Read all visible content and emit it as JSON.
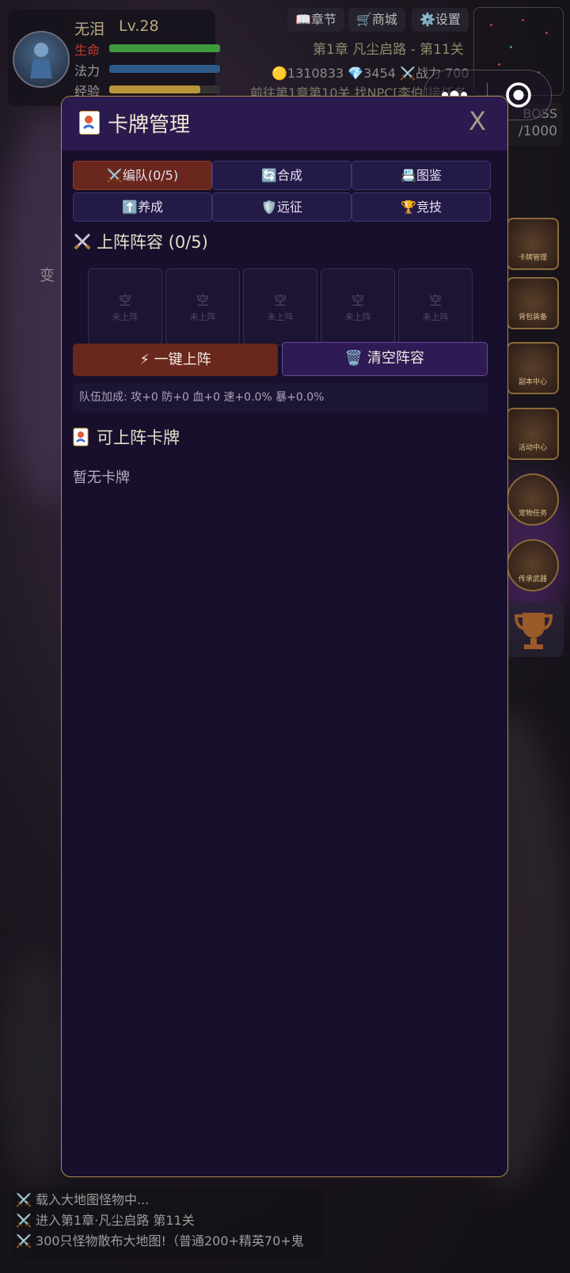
{
  "player": {
    "name": "无泪",
    "level": "Lv.28",
    "stats": [
      {
        "label": "生命",
        "color": "#c23a2f",
        "fill": "#3f9a3c"
      },
      {
        "label": "法力",
        "color": "#b0b0b0",
        "fill": "#2d6aa0"
      },
      {
        "label": "经验",
        "color": "#b0b0b0",
        "fill": "#c8a43c"
      }
    ]
  },
  "toolbar": {
    "chapter_btn": "📖章节",
    "shop_btn": "🛒商城",
    "settings_btn": "⚙️设置"
  },
  "stage": {
    "title": "第1章 凡尘启路 - 第11关",
    "gold": "🟡1310833",
    "gems": "💎3454",
    "power": "⚔️战力 700",
    "quest": "前往第1章第10关 找NPC[李伯]接任务"
  },
  "boss": {
    "label": "BOSS",
    "progress": "/1000"
  },
  "side_text": "变",
  "side_icons": [
    "卡牌管理",
    "背包装备",
    "副本中心",
    "活动中心",
    "宠物任务",
    "传承武器"
  ],
  "modal": {
    "title": "卡牌管理",
    "close": "X",
    "tabs": [
      {
        "label": "编队(0/5)",
        "icon": "⚔️",
        "active": true
      },
      {
        "label": "合成",
        "icon": "🔄",
        "active": false
      },
      {
        "label": "图鉴",
        "icon": "📇",
        "active": false
      },
      {
        "label": "养成",
        "icon": "⬆️",
        "active": false
      },
      {
        "label": "远征",
        "icon": "🛡️",
        "active": false
      },
      {
        "label": "竞技",
        "icon": "🏆",
        "active": false
      }
    ],
    "lineup_title": "上阵阵容 (0/5)",
    "slots": [
      {
        "main": "空",
        "sub": "未上阵"
      },
      {
        "main": "空",
        "sub": "未上阵"
      },
      {
        "main": "空",
        "sub": "未上阵"
      },
      {
        "main": "空",
        "sub": "未上阵"
      },
      {
        "main": "空",
        "sub": "未上阵"
      }
    ],
    "auto_fill_label": "⚡ 一键上阵",
    "clear_label": "🗑️ 清空阵容",
    "bonus_text": "队伍加成: 攻+0 防+0 血+0 速+0.0% 暴+0.0%",
    "available_title": "可上阵卡牌",
    "empty_text": "暂无卡牌"
  },
  "log": [
    "⚔️ 载入大地图怪物中...",
    "⚔️ 进入第1章·凡尘启路 第11关",
    "⚔️ 300只怪物散布大地图!（普通200+精英70+鬼"
  ]
}
